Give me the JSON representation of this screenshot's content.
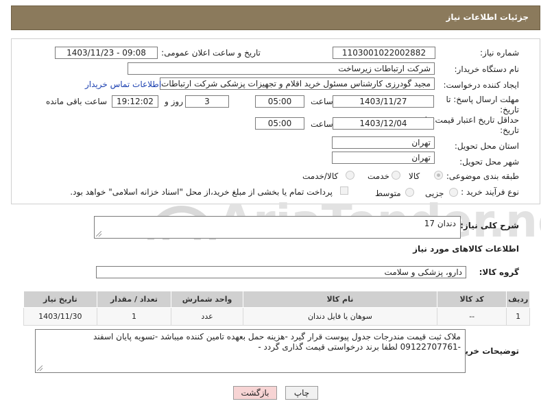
{
  "header": {
    "title": "جزئیات اطلاعات نیاز"
  },
  "form": {
    "need_number": {
      "label": "شماره نیاز:",
      "value": "1103001022002882"
    },
    "announce": {
      "label": "تاریخ و ساعت اعلان عمومی:",
      "value": "1403/11/23 - 09:08"
    },
    "buyer_org": {
      "label": "نام دستگاه خریدار:",
      "value": "شرکت ارتباطات زیرساخت"
    },
    "creator": {
      "label": "ایجاد کننده درخواست:",
      "value": "مجید گودرزی کارشناس مسئول خرید اقلام و تجهیزات پزشکی شرکت ارتباطات ز",
      "contact_link": "اطلاعات تماس خریدار"
    },
    "deadline": {
      "label_line1": "مهلت ارسال پاسخ: تا",
      "label_line2": "تاریخ:",
      "date": "1403/11/27",
      "time_label": "ساعت",
      "time": "05:00",
      "days": "3",
      "days_label": "روز و",
      "remaining": "19:12:02",
      "remaining_label": "ساعت باقی مانده"
    },
    "validity": {
      "label_line1": "حداقل تاریخ اعتبار قیمت: تا",
      "label_line2": "تاریخ:",
      "date": "1403/12/04",
      "time_label": "ساعت",
      "time": "05:00"
    },
    "province": {
      "label": "استان محل تحویل:",
      "value": "تهران"
    },
    "city": {
      "label": "شهر محل تحویل:",
      "value": "تهران"
    },
    "category": {
      "label": "طبقه بندی موضوعی:",
      "options": [
        "کالا",
        "خدمت",
        "کالا/خدمت"
      ],
      "selected": "کالا"
    },
    "purchase_type": {
      "label": "نوع فرآیند خرید :",
      "options": [
        "جزیی",
        "متوسط"
      ],
      "checkbox_text": "پرداخت تمام یا بخشی از مبلغ خرید،از محل \"اسناد خزانه اسلامی\" خواهد بود."
    }
  },
  "summary": {
    "label": "شرح کلی نیاز:",
    "value": "دندان 17"
  },
  "goods_info": {
    "title": "اطلاعات کالاهای مورد نیاز"
  },
  "goods_group": {
    "label": "گروه کالا:",
    "value": "دارو، پزشکی و سلامت"
  },
  "items_table": {
    "headers": [
      "ردیف",
      "کد کالا",
      "نام کالا",
      "واحد شمارش",
      "تعداد / مقدار",
      "تاریخ نیاز"
    ],
    "rows": [
      [
        "1",
        "--",
        "سوهان یا فایل دندان",
        "عدد",
        "1",
        "1403/11/30"
      ]
    ]
  },
  "buyer_notes": {
    "label": "توضیحات خریدار:",
    "line1": "ملاک ثبت قیمت مندرجات جدول پیوست قرار گیرد -هزینه حمل بعهده تامین کننده میباشد -تسویه پایان اسفند",
    "line2": "-09122707761 لطفا برند درخواستی قیمت گذاری گردد -"
  },
  "buttons": {
    "print": "چاپ",
    "back": "بازگشت"
  },
  "watermark": {
    "text": "AriaTender.net"
  },
  "colors": {
    "header_bg": "#8b7a5c",
    "link": "#1a3fb0",
    "back_button": "#f7d4d4"
  }
}
